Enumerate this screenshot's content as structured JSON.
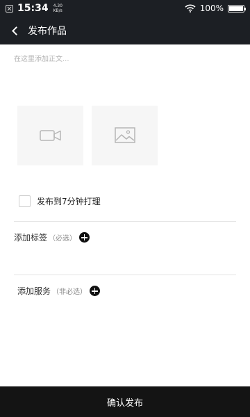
{
  "status_bar": {
    "time": "15:34",
    "net_speed_value": "4.30",
    "net_speed_unit": "KB/s",
    "battery_text": "100%",
    "battery_level": 1.0
  },
  "header": {
    "title": "发布作品"
  },
  "editor": {
    "placeholder": "在这里添加正文..."
  },
  "media_buttons": [
    {
      "icon": "video-camera-icon"
    },
    {
      "icon": "image-icon"
    }
  ],
  "sync_option": {
    "label": "发布到7分钟打理",
    "checked": false
  },
  "tags": {
    "label": "添加标签",
    "hint": "（必选）"
  },
  "services": {
    "label": "添加服务",
    "hint": "（非必选）"
  },
  "footer": {
    "confirm_label": "确认发布"
  },
  "colors": {
    "header_bg": "#1c1f24",
    "footer_bg": "#141414",
    "media_bg": "#f6f6f6"
  }
}
